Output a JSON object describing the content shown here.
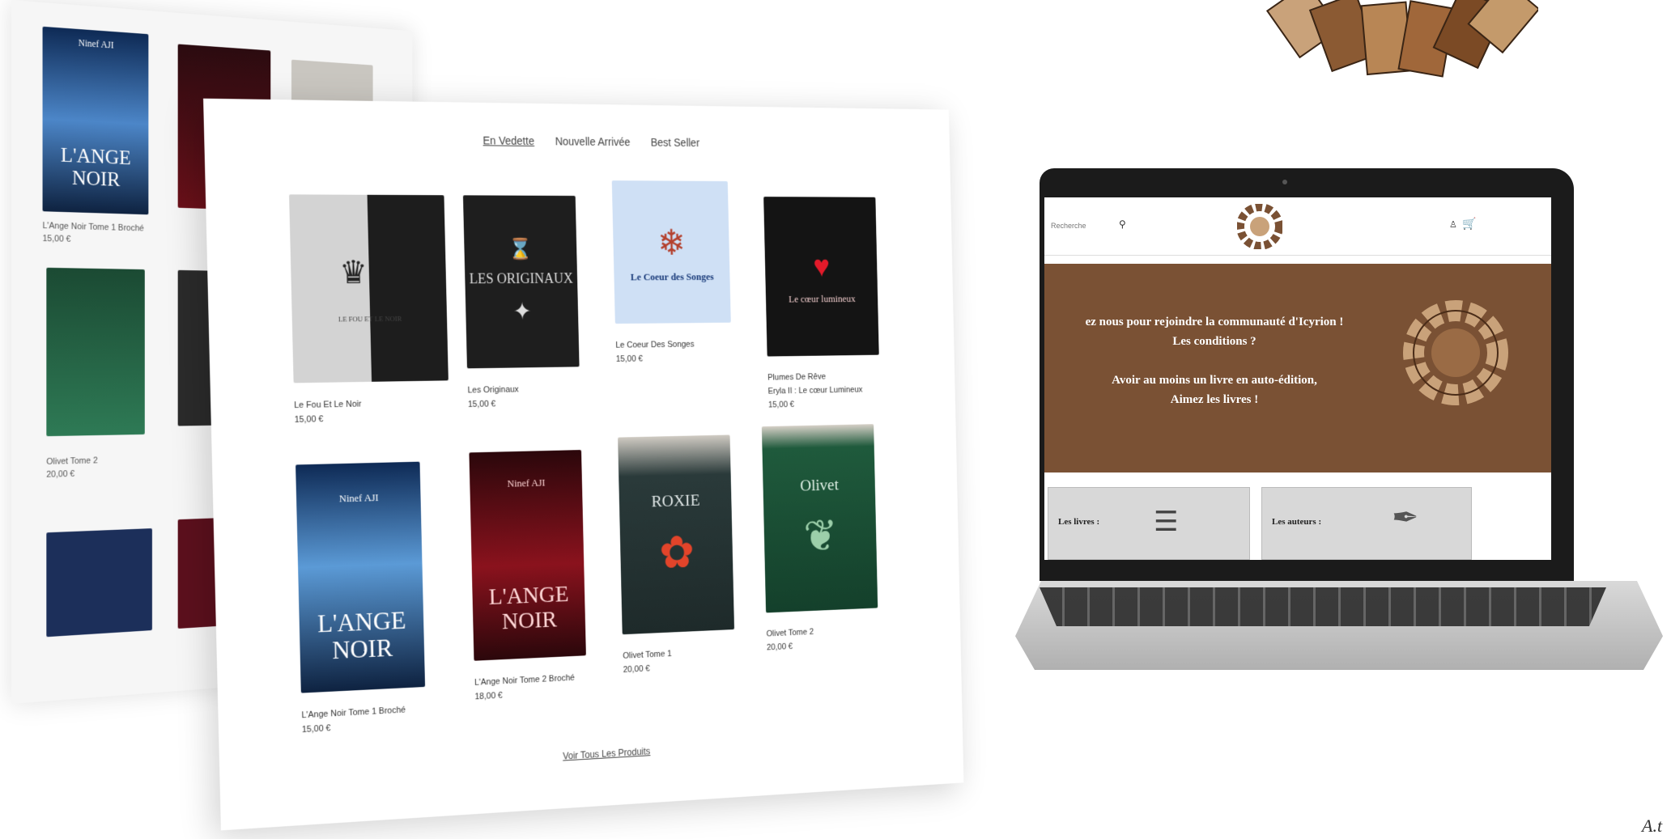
{
  "tabs": [
    {
      "label": "En Vedette",
      "active": true
    },
    {
      "label": "Nouvelle Arrivée",
      "active": false
    },
    {
      "label": "Best Seller",
      "active": false
    }
  ],
  "products_row1": [
    {
      "cover_text": "LE FOU ET LE NOIR",
      "title": "Le Fou Et Le Noir",
      "price": "15,00 €",
      "bg": "#c8c8c8"
    },
    {
      "cover_text": "LES ORIGINAUX",
      "title": "Les Originaux",
      "price": "15,00 €",
      "bg": "#1e1e1e"
    },
    {
      "cover_text": "Le Coeur des Songes",
      "title": "Le Coeur Des Songes",
      "price": "15,00 €",
      "bg": "#cfe0f5"
    },
    {
      "cover_text": "Le cœur lumineux",
      "title": "Eryla II : Le cœur Lumineux",
      "price": "15,00 €",
      "bg": "#141414",
      "subtitle": "Plumes De Rêve"
    }
  ],
  "products_row2": [
    {
      "cover_text": "L'ANGE NOIR",
      "author": "Ninef AJI",
      "title": "L'Ange Noir Tome 1 Broché",
      "price": "15,00 €",
      "bg": "#17325e"
    },
    {
      "cover_text": "L'ANGE NOIR",
      "author": "Ninef AJI",
      "title": "L'Ange Noir Tome 2 Broché",
      "price": "18,00 €",
      "bg": "#6d0d14"
    },
    {
      "cover_text": "ROXIE",
      "title": "Olivet Tome 1",
      "price": "20,00 €",
      "bg": "#2a3a3a"
    },
    {
      "cover_text": "Olivet",
      "title": "Olivet Tome 2",
      "price": "20,00 €",
      "bg": "#1f5a3c"
    }
  ],
  "see_all_label": "Voir Tous Les Produits",
  "back_panel": {
    "captions": [
      "L'Ange Noir Tome 1 Broché",
      "15,00 €",
      "Olivet Tome 2",
      "20,00 €"
    ],
    "top_book_text": "L'ANGE NOIR",
    "top_book_author": "Ninef AJI"
  },
  "laptop": {
    "search_placeholder": "Recherche",
    "hero_lines": [
      "ez nous pour rejoindre la communauté d'Icyrion !",
      "Les conditions ?",
      "",
      "Avoir au moins un livre en auto-édition,",
      "Aimez les livres !"
    ],
    "categories": [
      "Les livres :",
      "Les auteurs :"
    ]
  },
  "signature_text": "A.t",
  "colors": {
    "hero_brown": "#7a5134",
    "laptop_bezel": "#1b1b1b",
    "card_grey": "#d8d8d8"
  },
  "icons": [
    "search-icon",
    "user-icon",
    "cart-icon",
    "books-stack-icon",
    "quill-icon",
    "logo-emblem-icon"
  ]
}
